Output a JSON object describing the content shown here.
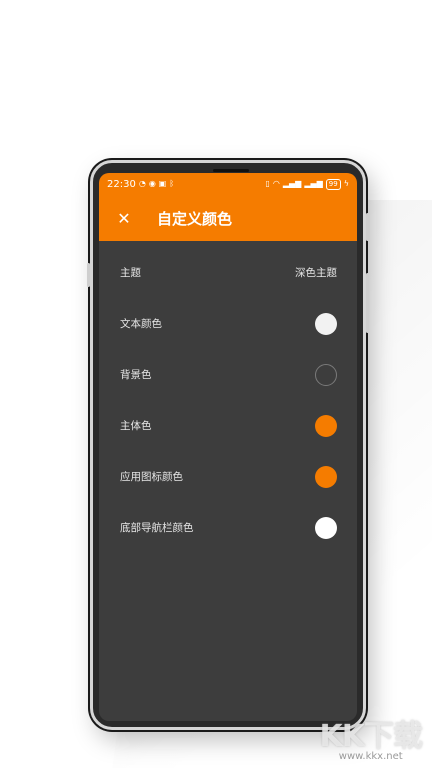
{
  "status_bar": {
    "time": "22:30",
    "battery": "99"
  },
  "app_bar": {
    "close_icon": "close-icon",
    "title": "自定义颜色"
  },
  "settings": [
    {
      "label": "主题",
      "value": "深色主题",
      "type": "text"
    },
    {
      "label": "文本颜色",
      "type": "color",
      "color": "#f2f2f2",
      "outline": false
    },
    {
      "label": "背景色",
      "type": "color",
      "color": "#3d3d3d",
      "outline": true
    },
    {
      "label": "主体色",
      "type": "color",
      "color": "#f57c00",
      "outline": false
    },
    {
      "label": "应用图标颜色",
      "type": "color",
      "color": "#f57c00",
      "outline": false
    },
    {
      "label": "底部导航栏颜色",
      "type": "color",
      "color": "#ffffff",
      "outline": false
    }
  ],
  "colors": {
    "accent": "#f57c00",
    "screen_bg": "#3d3d3d",
    "text": "#e6e6e6"
  },
  "watermark": {
    "brand": "KK下载",
    "url": "www.kkx.net"
  }
}
